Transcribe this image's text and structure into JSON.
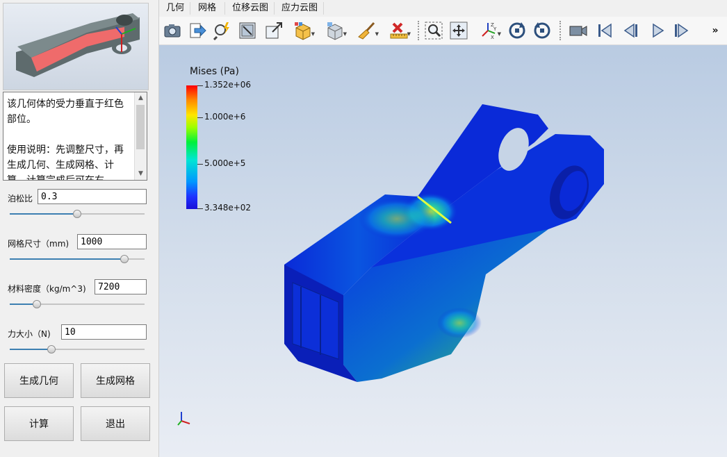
{
  "description": {
    "text": "该几何体的受力垂直于红色部位。\n\n使用说明：先调整尺寸，再生成几何、生成网格、计算，计算完成后可在右"
  },
  "params": [
    {
      "label": "泊松比",
      "value": "0.3",
      "slider_fraction": 0.5
    },
    {
      "label": "网格尺寸（mm)",
      "value": "1000",
      "slider_fraction": 0.85
    },
    {
      "label": "材料密度（kg/m^3)",
      "value": "7200",
      "slider_fraction": 0.2
    },
    {
      "label": "力大小（N)",
      "value": "10",
      "slider_fraction": 0.31
    }
  ],
  "buttons": {
    "gen_geometry": "生成几何",
    "gen_mesh": "生成网格",
    "compute": "计算",
    "exit": "退出"
  },
  "menu": [
    "几何",
    "网格",
    "位移云图",
    "应力云图"
  ],
  "toolbar": {
    "icons": [
      "camera-icon",
      "export-arrow-icon",
      "magic-zoom-icon",
      "fit-view-icon",
      "zoom-box-icon",
      "box-display-icon",
      "box-view-icon",
      "clean-brush-icon",
      "delete-ruler-icon",
      "zoom-region-icon",
      "pan-icon",
      "axes-icon",
      "rotate-cw-icon",
      "rotate-ccw-icon",
      "video-camera-icon",
      "first-frame-icon",
      "prev-frame-icon",
      "next-frame-icon",
      "last-frame-icon"
    ],
    "more_label": "»"
  },
  "legend": {
    "title": "Mises (Pa)",
    "max": "1.352e+06",
    "mid1": "1.000e+6",
    "mid2": "5.000e+5",
    "min": "3.348e+02"
  },
  "colors": {
    "accent": "#3c7fb1",
    "part_red": "#ef6b6b",
    "part_gray": "#5e6b6d",
    "mesh_blue": "#0a27d6"
  }
}
